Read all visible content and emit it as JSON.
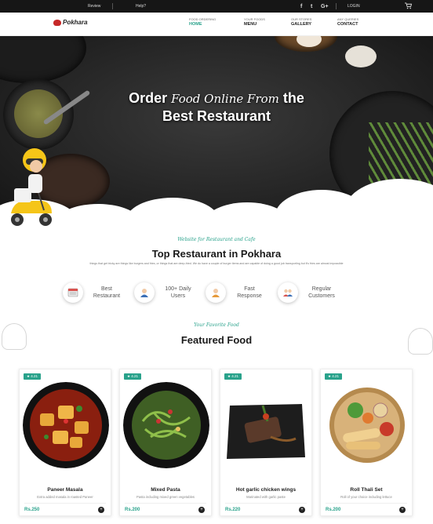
{
  "topbar": {
    "review": "Review",
    "help": "Help?",
    "login": "LOGIN",
    "social": [
      "f",
      "t",
      "G+"
    ]
  },
  "brand": {
    "name": "Pokhara"
  },
  "nav": [
    {
      "top": "FOOD ORDERING",
      "label": "HOME",
      "active": true
    },
    {
      "top": "YOUR FOODS",
      "label": "MENU",
      "active": false
    },
    {
      "top": "OUR STORES",
      "label": "GALLERY",
      "active": false
    },
    {
      "top": "ANY QUERIES",
      "label": "CONTACT",
      "active": false
    }
  ],
  "hero": {
    "line1_a": "Order",
    "line1_script": "Food Online From",
    "line1_b": "the",
    "line2": "Best Restaurant"
  },
  "about": {
    "subtitle": "Website for Restaurant and Cafe",
    "title": "Top Restaurant in Pokhara",
    "description": "things that get tricky are things like burgers and fries, or things that are deep-fried. We do have a couple of burger items and are capable of doing a good job transporting but it's fries are almost impossible",
    "features": [
      {
        "icon": "menu-board-icon",
        "line1": "Best",
        "line2": "Restaurant"
      },
      {
        "icon": "user-icon",
        "line1": "100+ Daily",
        "line2": "Users"
      },
      {
        "icon": "delivery-person-icon",
        "line1": "Fast",
        "line2": "Response"
      },
      {
        "icon": "customers-icon",
        "line1": "Regular",
        "line2": "Customers"
      }
    ]
  },
  "featured": {
    "subtitle": "Your Favorite Food",
    "title": "Featured Food",
    "items": [
      {
        "rating": "4.21",
        "name": "Paneer Masala",
        "description": "Extra added masala in roasted Paneer",
        "price": "Rs.250"
      },
      {
        "rating": "4.21",
        "name": "Mixed Pasta",
        "description": "Pasta including mixed green vegetables",
        "price": "Rs.200"
      },
      {
        "rating": "4.21",
        "name": "Hot garlic chicken wings",
        "description": "Marinated with garlic paste",
        "price": "Rs.220"
      },
      {
        "rating": "4.21",
        "name": "Roll Thali Set",
        "description": "Roll of your choice including lettuce",
        "price": "Rs.200"
      }
    ]
  },
  "colors": {
    "accent": "#29a28b",
    "dark": "#161616"
  }
}
